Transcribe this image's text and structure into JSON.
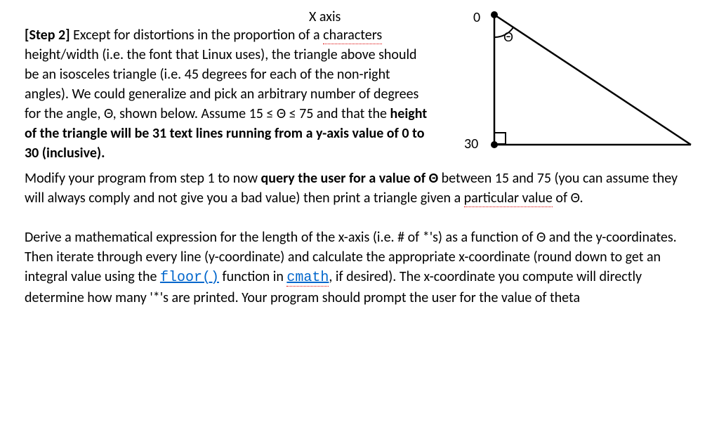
{
  "header": {
    "xaxis_label": "X axis"
  },
  "diagram": {
    "top_label": "0",
    "bottom_label": "30",
    "angle_label": "Θ"
  },
  "body": {
    "step_label": "[Step 2]",
    "p1_a": " Except for distortions in the proportion of a ",
    "p1_chars": "characters",
    "p1_b": " height/width (i.e. the font that Linux uses), the triangle above should be an isosceles triangle (i.e. 45 degrees for each of the non-right angles).  We could generalize and pick an arbitrary number of degrees for the angle, Θ, shown below.  Assume 15 ≤ Θ ≤ 75 and that the ",
    "p1_bold_height": "height of the triangle will be 31 text lines running from a y-axis value of 0 to 30 (inclusive).",
    "p2_a": "Modify your program from step 1 to now ",
    "p2_bold_query": "query the user for a value of Θ",
    "p2_b": " between 15 and 75 (you can assume they will always comply and not give you a bad value) then print a triangle given a ",
    "p2_partval": "particular value",
    "p2_c": " of Θ.",
    "p3_a": "Derive a mathematical expression for the length of the x-axis (i.e. # of *'s) as a function of Θ and the y-coordinates.  Then iterate through every line (y-coordinate) and calculate the appropriate x-coordinate (round down to get an integral value using the ",
    "p3_floor": "floor()",
    "p3_b": " function in ",
    "p3_cmath": "cmath",
    "p3_c": ", if desired).  The x-coordinate you compute will directly determine how many '*'s are printed.  Your program should prompt the user for the value of theta"
  }
}
